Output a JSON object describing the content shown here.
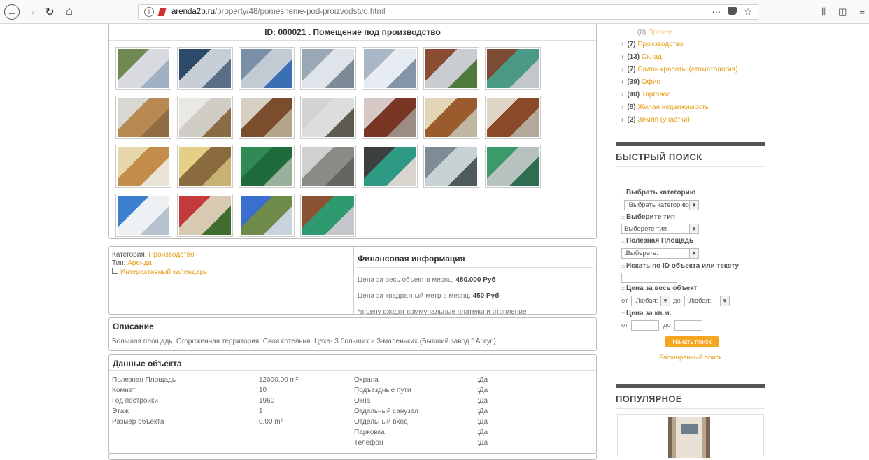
{
  "browser": {
    "url_host": "arenda2b.ru",
    "url_path": "/property/48/pomeshenie-pod-proizvodstvo.html",
    "overflow_label": "···"
  },
  "gallery": {
    "title": "ID: 000021 . Помещение под производство",
    "thumbnails": [
      {
        "colors": [
          "#6f8a52",
          "#d9dbe0",
          "#9fb0c2"
        ]
      },
      {
        "colors": [
          "#2e4a6b",
          "#c8ced6",
          "#5a6f86"
        ]
      },
      {
        "colors": [
          "#7b8fa6",
          "#c2cad4",
          "#3b6fb3"
        ]
      },
      {
        "colors": [
          "#9aa7b5",
          "#dfe4ea",
          "#7d8b99"
        ]
      },
      {
        "colors": [
          "#a9b7c6",
          "#e6ecf1",
          "#8395a7"
        ]
      },
      {
        "colors": [
          "#8a4c32",
          "#c9ccd1",
          "#4f7a3b"
        ]
      },
      {
        "colors": [
          "#7d4a34",
          "#4b9a86",
          "#c3c6ca"
        ]
      },
      {
        "colors": [
          "#d9d7d1",
          "#b88a52",
          "#8e6b41"
        ]
      },
      {
        "colors": [
          "#e9e8e3",
          "#cfcdc6",
          "#8a6c44"
        ]
      },
      {
        "colors": [
          "#d7cfc2",
          "#7a4e2c",
          "#b5a58d"
        ]
      },
      {
        "colors": [
          "#d3d4d4",
          "#dcdedd",
          "#5d5a4f"
        ]
      },
      {
        "colors": [
          "#d6c8c4",
          "#7a3624",
          "#9b8d82"
        ]
      },
      {
        "colors": [
          "#e3d6b7",
          "#9a5b2d",
          "#c0b6a4"
        ]
      },
      {
        "colors": [
          "#ded5c7",
          "#8a4a2a",
          "#b3a99a"
        ]
      },
      {
        "colors": [
          "#e4d7a9",
          "#c38c4a",
          "#eae4d6"
        ]
      },
      {
        "colors": [
          "#e4cf86",
          "#8a6b3e",
          "#c7b173"
        ]
      },
      {
        "colors": [
          "#2f8a55",
          "#1f6b3e",
          "#9bb09c"
        ]
      },
      {
        "colors": [
          "#cfd1d0",
          "#8c8a84",
          "#63665f"
        ]
      },
      {
        "colors": [
          "#3d3e3f",
          "#2f9a84",
          "#dad6cf"
        ]
      },
      {
        "colors": [
          "#7e8d95",
          "#c8d1d3",
          "#4e5a5e"
        ]
      },
      {
        "colors": [
          "#3a9a6a",
          "#b7c1bf",
          "#2c6e4f"
        ]
      },
      {
        "colors": [
          "#3a7fd0",
          "#eef1f4",
          "#b7c2cf"
        ]
      },
      {
        "colors": [
          "#c43a3a",
          "#d8c9b3",
          "#3e6d2e"
        ]
      },
      {
        "colors": [
          "#3a6fd0",
          "#6e8b4a",
          "#c9d3de"
        ]
      },
      {
        "colors": [
          "#8a5232",
          "#2f9a6f",
          "#c3c6ca"
        ]
      }
    ]
  },
  "info": {
    "category_label": "Категория:",
    "category_value": "Производство",
    "type_label": "Тип:",
    "type_value": "Аренда",
    "calendar_link": "Интерактивный календарь",
    "finance_title": "Финансовая информация",
    "price_total_label": "Цена за весь объект в месяц:",
    "price_total_value": "480.000 Руб",
    "price_sqm_label": "Цена за квадратный метр в месяц:",
    "price_sqm_value": "450 Руб",
    "note": "*в цену входят коммунальные платежи и отопление"
  },
  "description": {
    "title": "Описание",
    "text": "Большая площадь. Огороженная территория. Своя котельня. Цеха- 3 больших и 3-маленьких.(Бывший завод \" Аргус)."
  },
  "object_data": {
    "title": "Данные объекта",
    "left_rows": [
      {
        "label": "Полезная Площадь",
        "value": "12000.00 m²"
      },
      {
        "label": "Комнат",
        "value": "10"
      },
      {
        "label": "Год постройки",
        "value": "1960"
      },
      {
        "label": "Этаж",
        "value": "1"
      },
      {
        "label": "Размер объекта",
        "value": "0.00 m²"
      }
    ],
    "right_rows": [
      {
        "label": "Охрана",
        "value": ":Да"
      },
      {
        "label": "Подъездные пути",
        "value": ":Да"
      },
      {
        "label": "Окна",
        "value": ":Да"
      },
      {
        "label": "Отдельный санузел",
        "value": ":Да"
      },
      {
        "label": "Отдельный вход",
        "value": ":Да"
      },
      {
        "label": "Парковка",
        "value": ":Да"
      },
      {
        "label": "Телефон",
        "value": ":Да"
      }
    ]
  },
  "sidebar": {
    "categories": [
      {
        "count": "(0)",
        "name": "Прочее"
      },
      {
        "count": "(7)",
        "name": "Производство"
      },
      {
        "count": "(13)",
        "name": "Склад"
      },
      {
        "count": "(7)",
        "name": "Салон красоты (стоматология)"
      },
      {
        "count": "(39)",
        "name": "Офис"
      },
      {
        "count": "(40)",
        "name": "Торговое"
      },
      {
        "count": "(8)",
        "name": "Жилая недвижимость"
      },
      {
        "count": "(2)",
        "name": "Земля (участки)"
      }
    ],
    "quick_search_title": "БЫСТРЫЙ ПОИСК",
    "filters": {
      "category_label": "Выбрать категорию",
      "category_value": ":Выбрать категорию",
      "type_label": "Выберите тип",
      "type_value": "Выберете тип",
      "area_label": "Полезная Площадь",
      "area_value": ":Выберете:",
      "search_label": "Искать по ID объекта или тексту",
      "price_total_label": "Цена за весь объект",
      "from_label": "от",
      "to_label": "до",
      "any_value": ":Любая:",
      "price_sqm_label": "Цена за кв.м.",
      "search_button": "Начать поиск",
      "advanced_link": "Расширенный поиск"
    },
    "popular_title": "ПОПУЛЯРНОЕ"
  }
}
